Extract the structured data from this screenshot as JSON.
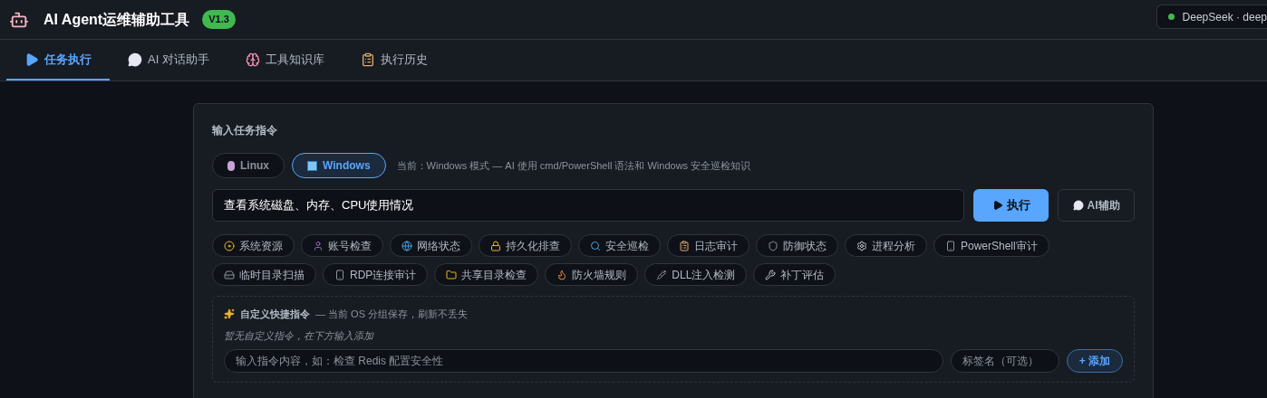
{
  "header": {
    "title": "AI Agent运维辅助工具",
    "version": "V1.3",
    "model_status": {
      "label": "DeepSeek · deep",
      "color": "#3fb950"
    }
  },
  "tabs": [
    {
      "label": "任务执行",
      "selected": true
    },
    {
      "label": "AI 对话助手",
      "selected": false
    },
    {
      "label": "工具知识库",
      "selected": false
    },
    {
      "label": "执行历史",
      "selected": false
    }
  ],
  "task_card": {
    "title": "输入任务指令",
    "os_options": [
      {
        "label": "Linux",
        "selected": false
      },
      {
        "label": "Windows",
        "selected": true
      }
    ],
    "os_note": "当前：Windows 模式 — AI 使用 cmd/PowerShell 语法和 Windows 安全巡检知识",
    "command_input": {
      "value": "查看系统磁盘、内存、CPU使用情况"
    },
    "execute_button": "执行",
    "assist_button": "AI辅助",
    "quick_commands": [
      "系统资源",
      "账号检查",
      "网络状态",
      "持久化排查",
      "安全巡检",
      "日志审计",
      "防御状态",
      "进程分析",
      "PowerShell审计",
      "临时目录扫描",
      "RDP连接审计",
      "共享目录检查",
      "防火墙规则",
      "DLL注入检测",
      "补丁评估"
    ],
    "custom_commands": {
      "title": "自定义快捷指令",
      "subtitle": "— 当前 OS 分组保存，刷新不丢失",
      "empty_note": "暂无自定义指令，在下方输入添加",
      "command_field": {
        "placeholder": "输入指令内容，如：检查 Redis 配置安全性"
      },
      "label_field": {
        "placeholder": "标签名（可选）"
      },
      "add_button": "+ 添加"
    }
  }
}
